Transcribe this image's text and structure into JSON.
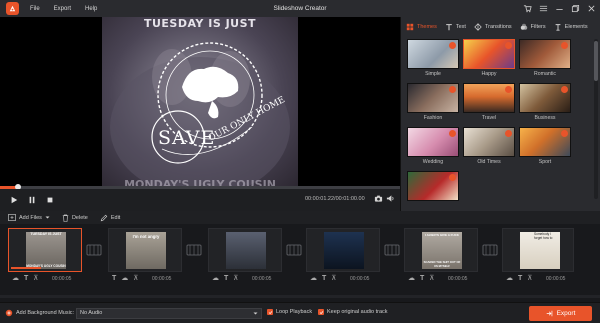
{
  "window": {
    "title": "Slideshow Creator"
  },
  "menu": {
    "file": "File",
    "export": "Export",
    "help": "Help"
  },
  "preview": {
    "top_text": "TUESDAY IS JUST",
    "bottom_text": "MONDAY'S UGLY COUSIN",
    "badge_save": "SAVE",
    "badge_sub": "OUR ONLY HOME",
    "timecode": "00:00:01.22/00:01:00.00",
    "progress": 0.045
  },
  "right_panel": {
    "tabs": [
      {
        "label": "Themes",
        "active": true
      },
      {
        "label": "Text",
        "active": false
      },
      {
        "label": "Transitions",
        "active": false
      },
      {
        "label": "Filters",
        "active": false
      },
      {
        "label": "Elements",
        "active": false
      }
    ],
    "themes": [
      "Simple",
      "Happy",
      "Romantic",
      "Fashion",
      "Travel",
      "Business",
      "Wedding",
      "Old Times",
      "Sport",
      ""
    ]
  },
  "toolbar": {
    "add_files": "Add Files",
    "delete": "Delete",
    "edit": "Edit"
  },
  "timeline": {
    "clips": [
      {
        "caption_top": "TUESDAY IS JUST",
        "caption_bottom": "MONDAY'S UGLY COUSIN",
        "duration": "00:00:05"
      },
      {
        "caption_top": "I'm not angry",
        "caption_bottom": "",
        "duration": "00:00:05"
      },
      {
        "caption_top": "",
        "caption_bottom": "",
        "duration": "00:00:05"
      },
      {
        "caption_top": "",
        "caption_bottom": "",
        "duration": "00:00:05"
      },
      {
        "caption_top": "I ALWAYS GIVE A FUCK",
        "caption_bottom": "SCARED THE SHIT OUT OF US MYSELF",
        "duration": "00:00:05"
      },
      {
        "caption_top": "Somebody I forget how to",
        "caption_bottom": "",
        "duration": "00:00:05"
      }
    ]
  },
  "footer": {
    "add_music": "Add Background Music:",
    "audio_value": "No Audio",
    "loop": "Loop Playback",
    "keep_audio": "Keep original audio track",
    "export": "Export"
  },
  "colors": {
    "accent": "#e8542a"
  }
}
